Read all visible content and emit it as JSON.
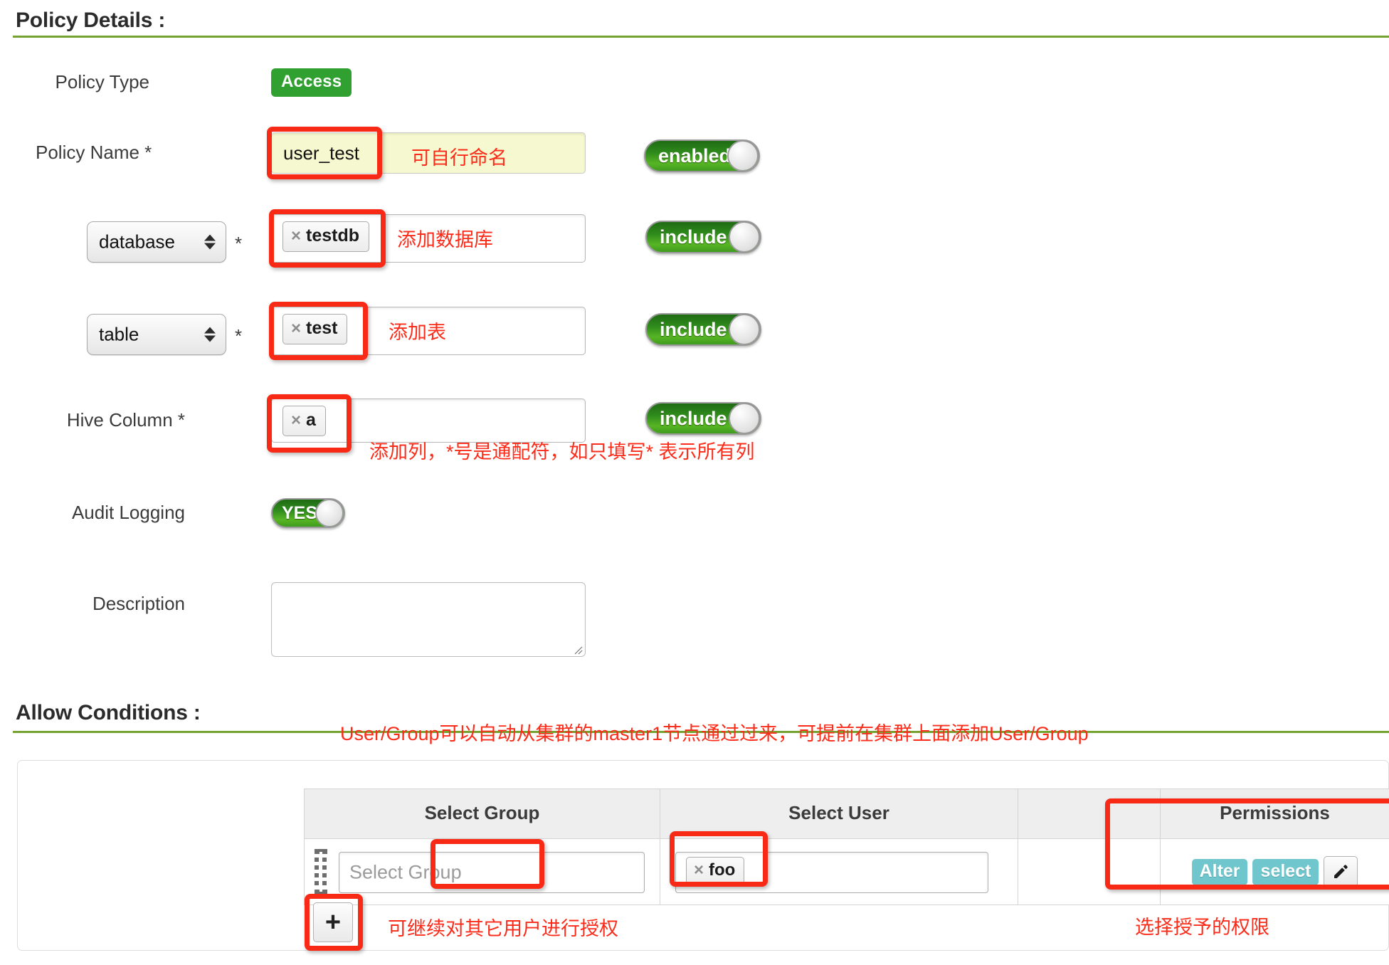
{
  "sections": {
    "policy_details_title": "Policy Details :",
    "allow_conditions_title": "Allow Conditions :"
  },
  "policy_details": {
    "policy_type": {
      "label": "Policy Type",
      "badge": "Access"
    },
    "policy_name": {
      "label": "Policy Name *",
      "value": "user_test",
      "annotation": "可自行命名",
      "toggle": "enabled"
    },
    "database": {
      "select_value": "database",
      "required_mark": "*",
      "chip_close": "×",
      "chip": "testdb",
      "annotation": "添加数据库",
      "toggle": "include"
    },
    "table": {
      "select_value": "table",
      "required_mark": "*",
      "chip_close": "×",
      "chip": "test",
      "annotation": "添加表",
      "toggle": "include"
    },
    "hive_column": {
      "label": "Hive Column *",
      "chip_close": "×",
      "chip": "a",
      "annotation": "添加列，*号是通配符，如只填写* 表示所有列",
      "toggle": "include"
    },
    "audit_logging": {
      "label": "Audit Logging",
      "toggle": "YES"
    },
    "description": {
      "label": "Description",
      "value": ""
    }
  },
  "allow_conditions": {
    "annotation": "User/Group可以自动从集群的master1节点通过过来，可提前在集群上面添加User/Group",
    "columns": [
      "Select Group",
      "Select User",
      "Permissions"
    ],
    "row": {
      "group_placeholder": "Select Group",
      "user_chip_close": "×",
      "user_chip": "foo",
      "permissions": [
        "Alter",
        "select"
      ],
      "edit_icon": "pencil-icon"
    },
    "add_button": "+",
    "add_annotation": "可继续对其它用户进行授权",
    "permissions_annotation": "选择授予的权限"
  },
  "colors": {
    "accent_green": "#74a331",
    "badge_green": "#30a030",
    "toggle_green": "#2f8b1c",
    "annotation_red": "#fb2c1a",
    "highlight_red": "#f82a16",
    "permission_teal": "#6fc6cd"
  }
}
